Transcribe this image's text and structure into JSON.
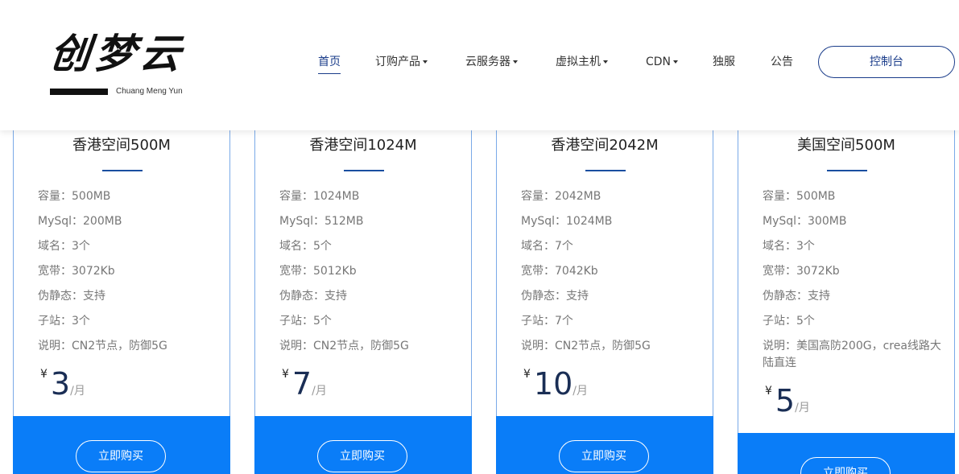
{
  "logo": {
    "mark": "创梦云",
    "sub": "Chuang Meng Yun"
  },
  "nav": {
    "items": [
      {
        "label": "首页",
        "active": true,
        "dropdown": false
      },
      {
        "label": "订购产品",
        "dropdown": true
      },
      {
        "label": "云服务器",
        "dropdown": true
      },
      {
        "label": "虚拟主机",
        "dropdown": true
      },
      {
        "label": "CDN",
        "dropdown": true
      },
      {
        "label": "独服",
        "dropdown": false
      },
      {
        "label": "公告",
        "dropdown": false
      }
    ],
    "console_label": "控制台"
  },
  "plans": [
    {
      "title": "香港空间500M",
      "specs": [
        "容量：500MB",
        "MySql：200MB",
        "域名：3个",
        "宽带：3072Kb",
        "伪静态：支持",
        "子站：3个",
        "说明：CN2节点，防御5G"
      ],
      "currency": "¥",
      "price": "3",
      "unit": "/月",
      "buy_label": "立即购买"
    },
    {
      "title": "香港空间1024M",
      "specs": [
        "容量：1024MB",
        "MySql：512MB",
        "域名：5个",
        "宽带：5012Kb",
        "伪静态：支持",
        "子站：5个",
        "说明：CN2节点，防御5G"
      ],
      "currency": "¥",
      "price": "7",
      "unit": "/月",
      "buy_label": "立即购买"
    },
    {
      "title": "香港空间2042M",
      "specs": [
        "容量：2042MB",
        "MySql：1024MB",
        "域名：7个",
        "宽带：7042Kb",
        "伪静态：支持",
        "子站：7个",
        "说明：CN2节点，防御5G"
      ],
      "currency": "¥",
      "price": "10",
      "unit": "/月",
      "buy_label": "立即购买"
    },
    {
      "title": "美国空间500M",
      "specs": [
        "容量：500MB",
        "MySql：300MB",
        "域名：3个",
        "宽带：3072Kb",
        "伪静态：支持",
        "子站：5个",
        "说明：美国高防200G，crea线路大陆直连"
      ],
      "currency": "¥",
      "price": "5",
      "unit": "/月",
      "buy_label": "立即购买"
    }
  ],
  "colors": {
    "accent": "#1a3c8a",
    "card_border": "#7aaae8",
    "buy_band": "#0a7df8",
    "spec_text": "#777777"
  }
}
